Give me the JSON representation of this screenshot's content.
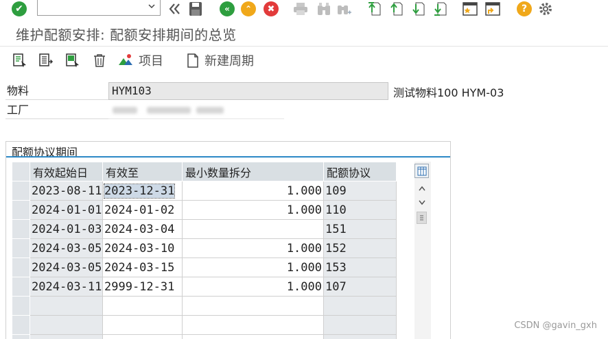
{
  "toolbar": {
    "command_field_value": "",
    "icons": [
      "enter-icon",
      "command-dropdown-icon",
      "history-icon",
      "save-icon",
      "back-icon",
      "exit-icon",
      "cancel-icon",
      "print-icon",
      "find-icon",
      "find-next-icon",
      "first-page-icon",
      "prev-page-icon",
      "next-page-icon",
      "last-page-icon",
      "new-session-icon",
      "shortcut-icon",
      "help-icon",
      "settings-icon"
    ],
    "colors": {
      "enter": "#2e9e3f",
      "back": "#2e9e3f",
      "exit": "#f0a81a",
      "cancel": "#e23b3b",
      "help": "#f0a81a",
      "nav_arrows": "#2e9e3f"
    }
  },
  "page": {
    "title": "维护配额安排: 配额安排期间的总览"
  },
  "app_toolbar": {
    "items_label": "项目",
    "new_period_label": "新建周期"
  },
  "header": {
    "material_label": "物料",
    "material_value": "HYM103",
    "material_description": "测试物料100 HYM-03",
    "plant_label": "工厂",
    "plant_value": ""
  },
  "group": {
    "title": "配额协议期间"
  },
  "table": {
    "columns": [
      "有效起始日",
      "有效至",
      "最小数量拆分",
      "配额协议"
    ],
    "rows": [
      {
        "valid_from": "2023-08-11",
        "valid_to": "2023-12-31",
        "min_qty": "1.000",
        "quota": "109"
      },
      {
        "valid_from": "2024-01-01",
        "valid_to": "2024-01-02",
        "min_qty": "1.000",
        "quota": "110"
      },
      {
        "valid_from": "2024-01-03",
        "valid_to": "2024-03-04",
        "min_qty": "",
        "quota": "151"
      },
      {
        "valid_from": "2024-03-05",
        "valid_to": "2024-03-10",
        "min_qty": "1.000",
        "quota": "152"
      },
      {
        "valid_from": "2024-03-05",
        "valid_to": "2024-03-15",
        "min_qty": "1.000",
        "quota": "153"
      },
      {
        "valid_from": "2024-03-11",
        "valid_to": "2999-12-31",
        "min_qty": "1.000",
        "quota": "107"
      }
    ],
    "selected_cell": "2023-12-31"
  },
  "watermark": "CSDN @gavin_gxh"
}
